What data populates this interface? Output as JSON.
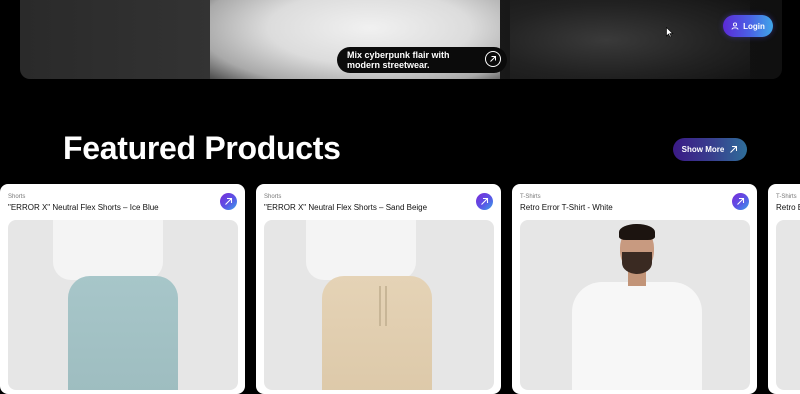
{
  "hero": {
    "caption": "Mix cyberpunk flair with modern streetwear.",
    "caption_icon": "arrow-up-right-icon"
  },
  "header": {
    "login_label": "Login",
    "login_icon": "user-icon"
  },
  "featured": {
    "title": "Featured Products",
    "show_more_label": "Show More",
    "show_more_icon": "arrow-up-right-icon"
  },
  "products": [
    {
      "category": "Shorts",
      "name": "\"ERROR X\" Neutral Flex Shorts – Ice Blue"
    },
    {
      "category": "Shorts",
      "name": "\"ERROR X\" Neutral Flex Shorts – Sand Beige"
    },
    {
      "category": "T-Shirts",
      "name": "Retro Error T-Shirt - White"
    },
    {
      "category": "T-Shirts",
      "name": "Retro E"
    }
  ],
  "colors": {
    "background": "#000000",
    "accent_gradient_start": "#5b2ad6",
    "accent_gradient_end": "#3fa6e8",
    "card_background": "#ffffff"
  }
}
